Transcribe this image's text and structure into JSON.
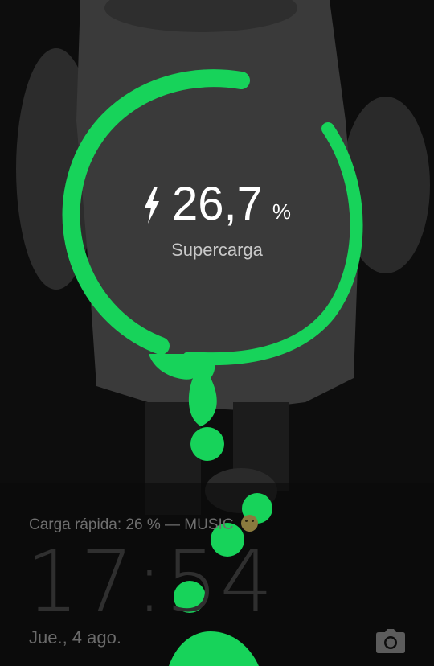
{
  "charging": {
    "percent_value": "26,7",
    "percent_unit": "%",
    "mode_label": "Supercarga",
    "level_percent": 26.7
  },
  "lockscreen": {
    "status_text": "Carga rápida: 26 % — MUSIC",
    "clock": "17:54",
    "date": "Jue., 4 ago."
  },
  "icons": {
    "bolt": "lightning-bolt-icon",
    "camera": "camera-icon",
    "emoji": "smiling-face-emoji-icon"
  },
  "colors": {
    "accent_green": "#17d35a",
    "text_primary": "#ffffff",
    "text_secondary": "#c9c9c9",
    "lockscreen_text": "#6f6f6f"
  }
}
